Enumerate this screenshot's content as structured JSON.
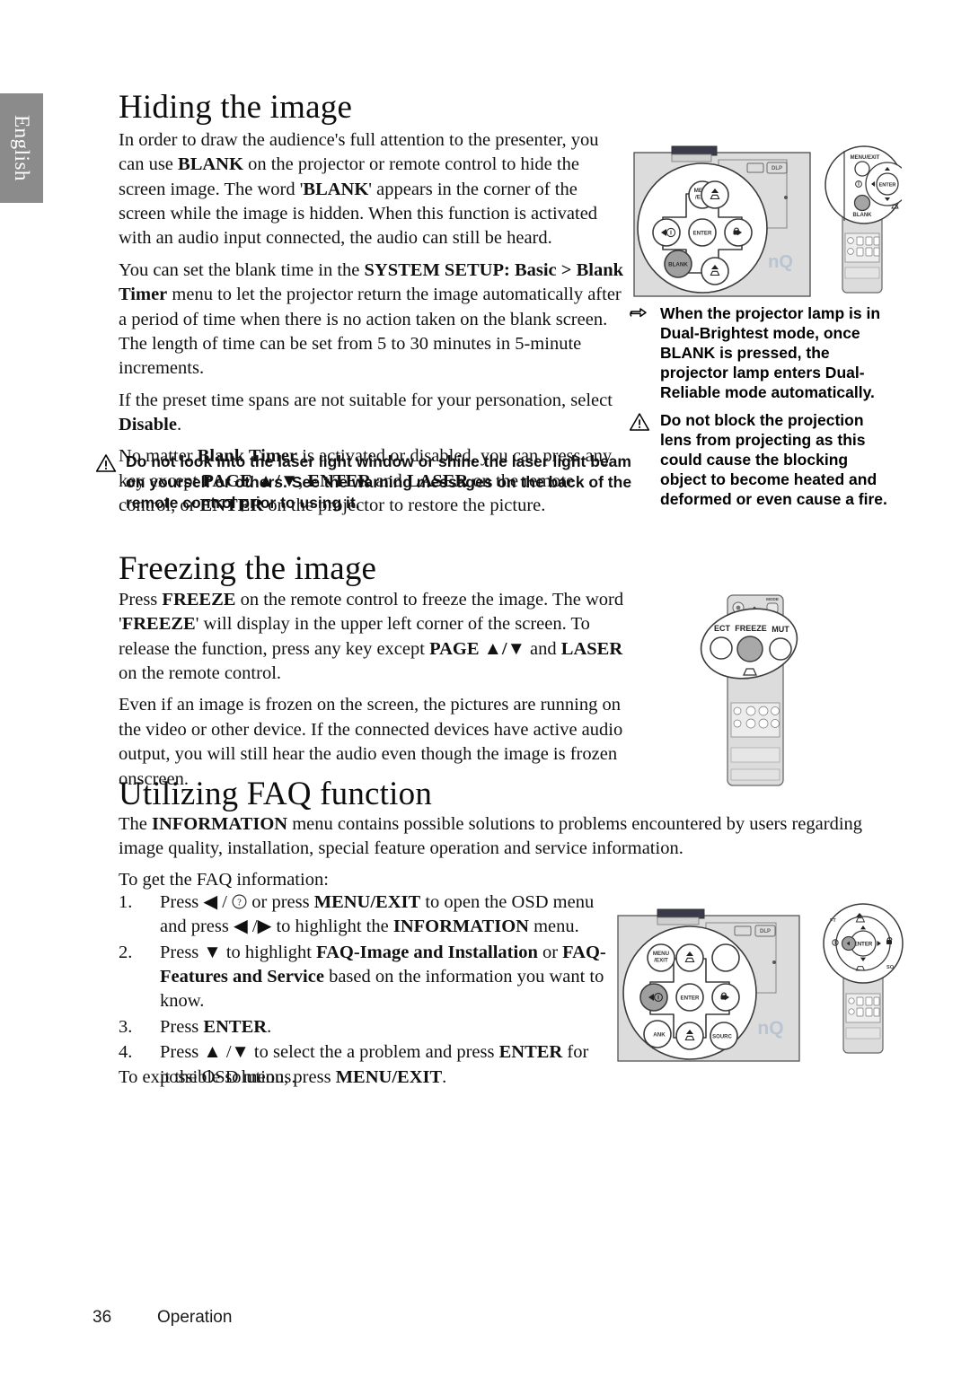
{
  "language_tab": "English",
  "sections": {
    "hiding": {
      "title": "Hiding the image",
      "p1_a": "In order to draw the audience's full attention to the presenter, you can use ",
      "p1_blank1": "BLANK",
      "p1_b": " on the projector or remote control to hide the screen image. The word '",
      "p1_blank2": "BLANK",
      "p1_c": "' appears in the corner of the screen while the image is hidden. When this function is activated with an audio input connected, the audio can still be heard.",
      "p2_a": "You can set the blank time in the ",
      "p2_menu": "SYSTEM SETUP: Basic > Blank Timer",
      "p2_b": " menu to let the projector return the image automatically after a period of time when there is no action taken on the blank screen. The length of time can be set from 5 to 30 minutes in 5-minute increments.",
      "p3_a": "If the preset time spans are not suitable for your personation, select ",
      "p3_disable": "Disable",
      "p3_b": ".",
      "p4_a": "No matter ",
      "p4_blanktimer": "Blank Timer",
      "p4_b": " is activated or disabled, you can press any key except ",
      "p4_page": "PAGE ▲/▼",
      "p4_c": ", ",
      "p4_enter": "ENTER",
      "p4_d": " and ",
      "p4_laser": "LASER",
      "p4_e": " on the remote control, or ",
      "p4_enter2": "ENTER",
      "p4_f": " on the projector to restore the picture."
    },
    "freezing": {
      "title": "Freezing the image",
      "p1_a": "Press ",
      "p1_freeze": "FREEZE",
      "p1_b": " on the remote control to freeze the image. The word '",
      "p1_freeze2": "FREEZE",
      "p1_c": "' will display in the upper left corner of the screen. To release the function, press any key except ",
      "p1_page": "PAGE ▲/▼",
      "p1_d": " and ",
      "p1_laser": "LASER",
      "p1_e": " on the remote control.",
      "p2": "Even if an image is frozen on the screen, the pictures are running on the video or other device. If the connected devices have active audio output, you will still hear the audio even though the image is frozen onscreen."
    },
    "faq": {
      "title": "Utilizing FAQ function",
      "p1_a": "The ",
      "p1_info": "INFORMATION",
      "p1_b": " menu contains possible solutions to problems encountered by users regarding image quality, installation, special feature operation and service information.",
      "p2": "To get the FAQ information:",
      "steps": [
        {
          "num": "1.",
          "a": "Press ◀ / ",
          "has_help_icon": true,
          "b": " or press ",
          "bold1": "MENU/EXIT",
          "c": " to open the OSD menu and press ◀ /▶ to highlight the ",
          "bold2": "INFORMATION",
          "d": " menu."
        },
        {
          "num": "2.",
          "a": "Press ▼ to highlight ",
          "bold1": "FAQ-Image and Installation",
          "b": " or ",
          "bold2": "FAQ-Features and Service",
          "c": " based on the information you want to know."
        },
        {
          "num": "3.",
          "a": "Press ",
          "bold1": "ENTER",
          "b": "."
        },
        {
          "num": "4.",
          "a": "Press ▲ /▼ to select the a problem and press ",
          "bold1": "ENTER",
          "b": " for possible solutions."
        }
      ],
      "closing_a": "To exit the OSD menu, press ",
      "closing_bold": "MENU/EXIT",
      "closing_b": "."
    }
  },
  "notes": {
    "dual_brightest": {
      "icon": "pointing-hand-icon",
      "text": "When the projector lamp is in Dual-Brightest mode, once BLANK is pressed, the projector lamp enters Dual-Reliable mode automatically."
    },
    "block_lens": {
      "icon": "warning-triangle-icon",
      "text": "Do not block the projection lens from projecting as this could cause the blocking object to become heated and deformed or even cause a fire."
    },
    "laser_warning": {
      "icon": "warning-triangle-icon",
      "text": "Do not look into the laser light window or shine the laser light beam on yourself or others. See the warning messages on the back of the remote control prior to using it."
    }
  },
  "illustrations": {
    "projector_panel_top": {
      "brand": "BenQ",
      "badge_dlp": "DLP",
      "buttons": [
        "MENU/EXIT",
        "ENTER",
        "BLANK"
      ],
      "highlighted": "BLANK"
    },
    "remote_top": {
      "labels": [
        "MENU/EXIT",
        "ENTER",
        "BLANK"
      ],
      "highlighted": "BLANK"
    },
    "remote_freeze": {
      "labels": [
        "ECT",
        "FREEZE",
        "MUT"
      ],
      "mode_label": "MODE",
      "highlighted": "FREEZE"
    },
    "projector_panel_bottom": {
      "brand": "BenQ",
      "badge_dlp": "DLP",
      "buttons": [
        "MENU/EXIT",
        "ENTER",
        "BLANK",
        "SOURCE"
      ],
      "highlighted": "left-arrow"
    },
    "remote_bottom": {
      "labels": [
        "ENTER",
        "SOURCE"
      ],
      "highlighted": "left-arrow"
    }
  },
  "footer": {
    "page_number": "36",
    "section": "Operation"
  }
}
